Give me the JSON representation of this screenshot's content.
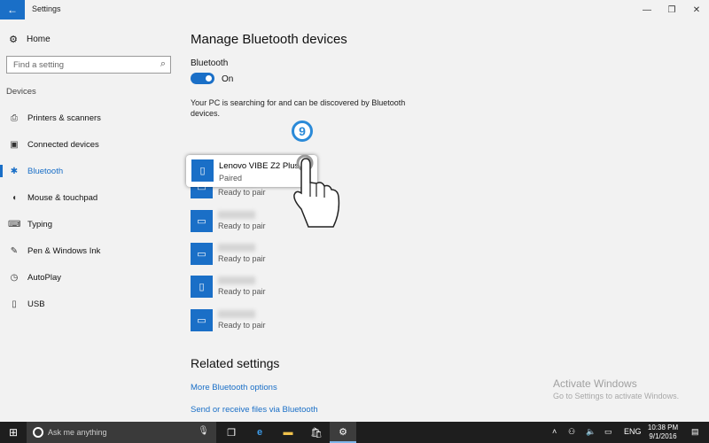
{
  "window": {
    "title": "Settings",
    "back_icon": "←",
    "minimize_icon": "—",
    "restore_icon": "❐",
    "close_icon": "✕"
  },
  "sidebar": {
    "home_label": "Home",
    "search_placeholder": "Find a setting",
    "section_label": "Devices",
    "items": [
      {
        "label": "Printers & scanners",
        "icon": "⎙"
      },
      {
        "label": "Connected devices",
        "icon": "▣"
      },
      {
        "label": "Bluetooth",
        "icon": "✱"
      },
      {
        "label": "Mouse & touchpad",
        "icon": "◖"
      },
      {
        "label": "Typing",
        "icon": "⌨"
      },
      {
        "label": "Pen & Windows Ink",
        "icon": "✎"
      },
      {
        "label": "AutoPlay",
        "icon": "◷"
      },
      {
        "label": "USB",
        "icon": "▯"
      }
    ]
  },
  "main": {
    "title": "Manage Bluetooth devices",
    "bluetooth_label": "Bluetooth",
    "toggle_state": "On",
    "description": "Your PC is searching for and can be discovered by Bluetooth devices.",
    "paired_device": {
      "name": "Lenovo VIBE Z2 Plus",
      "status": "Paired"
    },
    "devices": [
      {
        "status": "Ready to pair"
      },
      {
        "status": "Ready to pair"
      },
      {
        "status": "Ready to pair"
      },
      {
        "status": "Ready to pair"
      },
      {
        "status": "Ready to pair"
      }
    ],
    "step_badge": "9",
    "related_title": "Related settings",
    "links": [
      "More Bluetooth options",
      "Send or receive files via Bluetooth"
    ]
  },
  "watermark": {
    "line1": "Activate Windows",
    "line2": "Go to Settings to activate Windows."
  },
  "taskbar": {
    "search_placeholder": "Ask me anything",
    "language": "ENG",
    "time": "10:38 PM",
    "date": "9/1/2016"
  },
  "colors": {
    "accent": "#1a6fc7",
    "taskbar": "#1e1e1e",
    "background": "#f2f2f2"
  }
}
